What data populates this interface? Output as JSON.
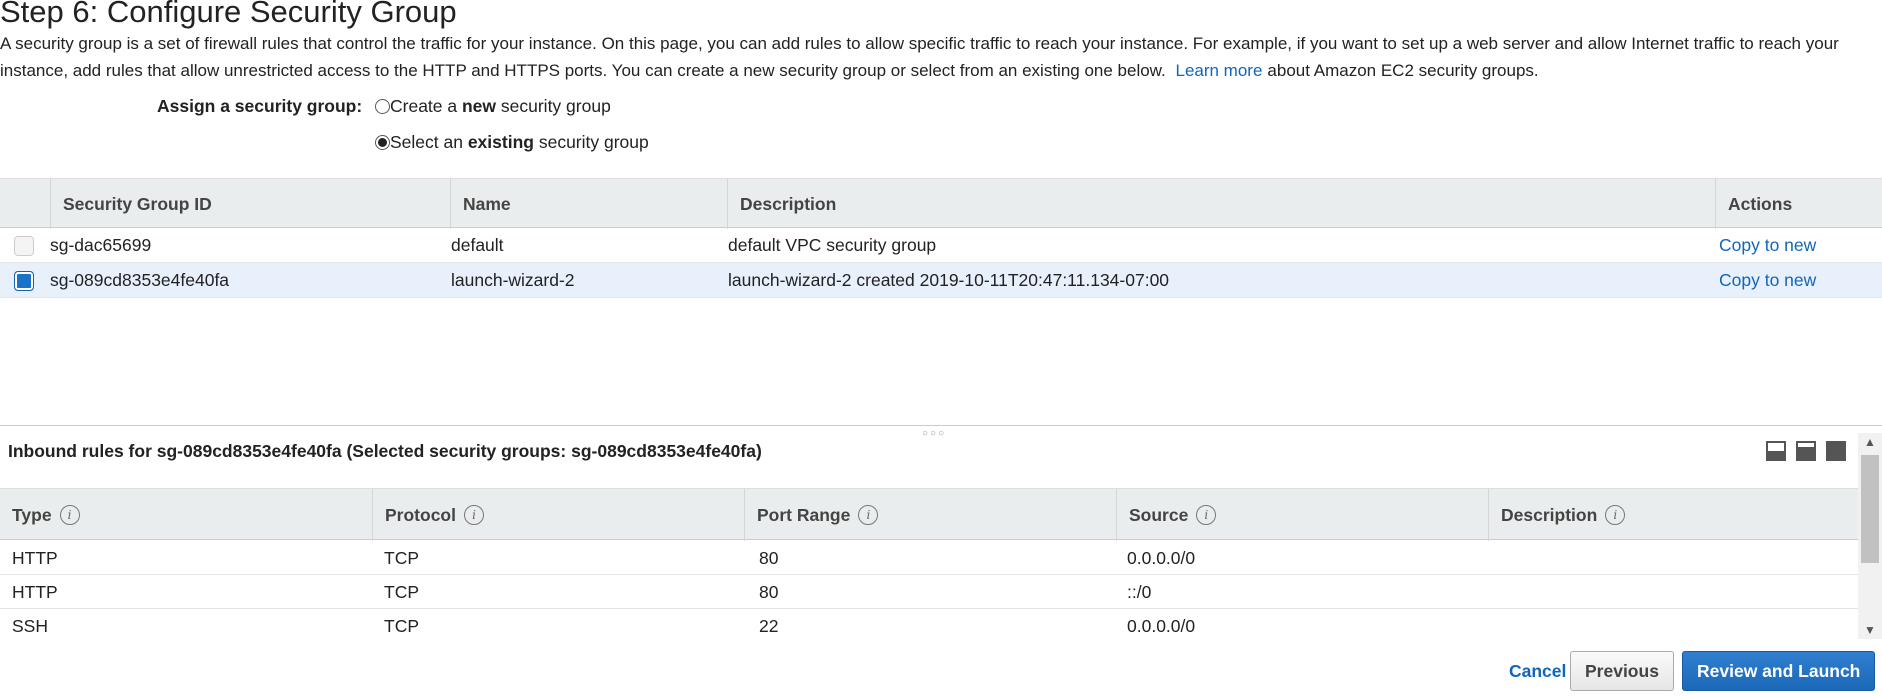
{
  "page": {
    "title": "Step 6: Configure Security Group",
    "description_part1": "A security group is a set of firewall rules that control the traffic for your instance. On this page, you can add rules to allow specific traffic to reach your instance. For example, if you want to set up a web server and allow Internet traffic to reach your instance, add rules that allow unrestricted access to the HTTP and HTTPS ports. You can create a new security group or select from an existing one below.",
    "learn_more": "Learn more",
    "description_part2": "about Amazon EC2 security groups."
  },
  "assign": {
    "label": "Assign a security group:",
    "option_new_prefix": "Create a ",
    "option_new_bold": "new",
    "option_new_suffix": " security group",
    "option_existing_prefix": "Select an ",
    "option_existing_bold": "existing",
    "option_existing_suffix": " security group",
    "selected": "existing"
  },
  "sg_table": {
    "headers": {
      "id": "Security Group ID",
      "name": "Name",
      "description": "Description",
      "actions": "Actions"
    },
    "rows": [
      {
        "id": "sg-dac65699",
        "name": "default",
        "description": "default VPC security group",
        "action": "Copy to new",
        "checked": false
      },
      {
        "id": "sg-089cd8353e4fe40fa",
        "name": "launch-wizard-2",
        "description": "launch-wizard-2 created 2019-10-11T20:47:11.134-07:00",
        "action": "Copy to new",
        "checked": true
      }
    ]
  },
  "inbound": {
    "title": "Inbound rules for sg-089cd8353e4fe40fa (Selected security groups: sg-089cd8353e4fe40fa)",
    "headers": {
      "type": "Type",
      "protocol": "Protocol",
      "port_range": "Port Range",
      "source": "Source",
      "description": "Description"
    },
    "info_glyph": "i",
    "rows": [
      {
        "type": "HTTP",
        "protocol": "TCP",
        "port": "80",
        "source": "0.0.0.0/0",
        "description": ""
      },
      {
        "type": "HTTP",
        "protocol": "TCP",
        "port": "80",
        "source": "::/0",
        "description": ""
      },
      {
        "type": "SSH",
        "protocol": "TCP",
        "port": "22",
        "source": "0.0.0.0/0",
        "description": ""
      }
    ]
  },
  "buttons": {
    "cancel": "Cancel",
    "previous": "Previous",
    "review_launch": "Review and Launch"
  },
  "colors": {
    "link": "#1166bb",
    "primary_button": "#1c68b8",
    "selected_row": "#e8f0fb"
  }
}
